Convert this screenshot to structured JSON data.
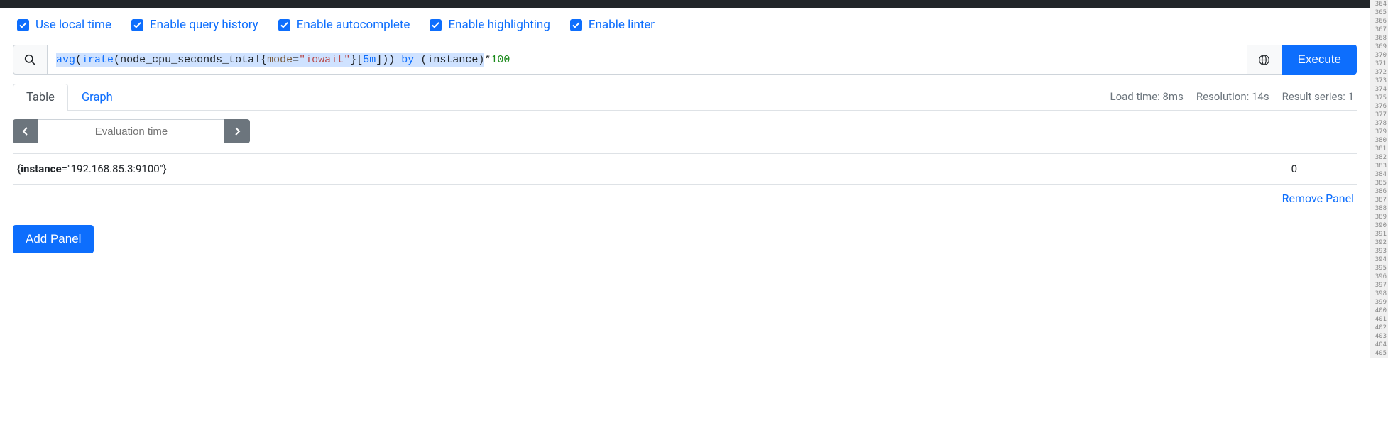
{
  "options": [
    {
      "label": "Use local time",
      "checked": true
    },
    {
      "label": "Enable query history",
      "checked": true
    },
    {
      "label": "Enable autocomplete",
      "checked": true
    },
    {
      "label": "Enable highlighting",
      "checked": true
    },
    {
      "label": "Enable linter",
      "checked": true
    }
  ],
  "query": {
    "tokens": {
      "avg": "avg",
      "p1": "(",
      "irate": "irate",
      "p2": "(",
      "metric": "node_cpu_seconds_total",
      "lb": "{",
      "label": "mode",
      "eq": "=",
      "q1": "\"",
      "str": "iowait",
      "q2": "\"",
      "rb": "}",
      "lbr": "[",
      "range": "5m",
      "rbr": "]",
      "p3": ")",
      "p4": ")",
      "by": " by ",
      "p5": "(",
      "inst": "instance",
      "p6": ")",
      "mul": " * ",
      "num": "100"
    },
    "execute_label": "Execute"
  },
  "tabs": {
    "table": "Table",
    "graph": "Graph"
  },
  "stats": {
    "load": "Load time: 8ms",
    "resolution": "Resolution: 14s",
    "series": "Result series: 1"
  },
  "eval": {
    "placeholder": "Evaluation time"
  },
  "result": {
    "lb": "{",
    "key": "instance",
    "rest": "=\"192.168.85.3:9100\"}",
    "value": "0"
  },
  "links": {
    "remove": "Remove Panel",
    "add": "Add Panel"
  },
  "ruler": {
    "start": 364,
    "end": 405
  }
}
